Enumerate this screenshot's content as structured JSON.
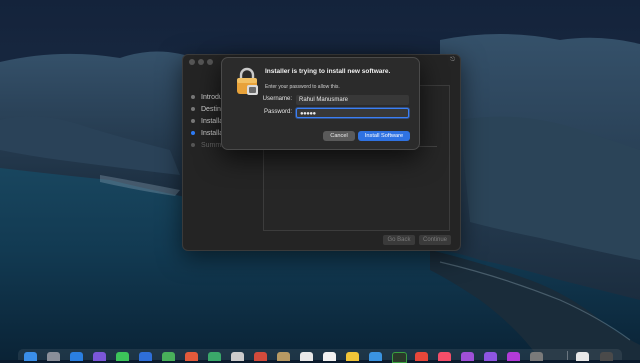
{
  "installer": {
    "steps": [
      {
        "label": "Introduc",
        "state": "done"
      },
      {
        "label": "Destinat",
        "state": "done"
      },
      {
        "label": "Installati",
        "state": "done"
      },
      {
        "label": "Installat",
        "state": "active"
      },
      {
        "label": "Summar",
        "state": "pending"
      }
    ],
    "go_back_label": "Go Back",
    "continue_label": "Continue"
  },
  "dialog": {
    "title": "Installer is trying to install new software.",
    "subtitle": "Enter your password to allow this.",
    "username_label": "Username:",
    "username_value": "Rahul Manusmare",
    "password_label": "Password:",
    "password_masked": "●●●●●",
    "cancel_label": "Cancel",
    "install_label": "Install Software"
  },
  "colors": {
    "accent": "#2f72e2",
    "dialog_bg": "#2b2b2b",
    "window_bg": "#242424"
  },
  "dock": {
    "icons": [
      "finder-icon",
      "launchpad-icon",
      "safari-icon",
      "messages-icon",
      "mail-icon",
      "maps-icon",
      "photos-icon",
      "facetime-icon",
      "calendar-icon",
      "contacts-icon",
      "reminders-icon",
      "notes-icon",
      "appletv-icon",
      "music-icon",
      "podcasts-icon",
      "news-icon",
      "appstore-icon",
      "activity-monitor-icon",
      "settings-icon",
      "downloads-icon",
      "trash-icon"
    ]
  }
}
